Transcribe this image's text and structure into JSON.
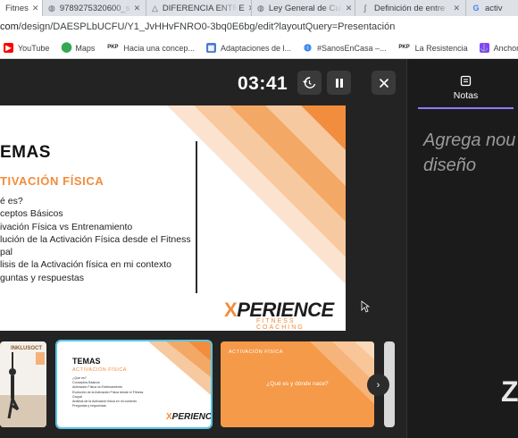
{
  "browser": {
    "tabs": [
      {
        "label": "Fitnes",
        "active": true
      },
      {
        "label": "9789275320600_s"
      },
      {
        "label": "DIFERENCIA ENTRE"
      },
      {
        "label": "Ley General de Cul"
      },
      {
        "label": "Definición de entre"
      },
      {
        "label": "activ"
      }
    ],
    "url_host": "com",
    "url_path": "/design/DAESPLbUCFU/Y1_JvHHvFNRO0-3bq0E6bg/edit?layoutQuery=Presentación",
    "bookmarks": [
      {
        "label": "YouTube",
        "icon": "youtube-icon",
        "color": "#ff0000"
      },
      {
        "label": "Maps",
        "icon": "maps-pin-icon",
        "color": "#34a853"
      },
      {
        "label": "Hacia una concep...",
        "icon": "pkp-icon",
        "color": "#222222"
      },
      {
        "label": "Adaptaciones de l...",
        "icon": "grid-icon",
        "color": "#4a7bd0"
      },
      {
        "label": "#SanosEnCasa –...",
        "icon": "globe-icon",
        "color": "#1a73e8"
      },
      {
        "label": "La Resistencia",
        "icon": "pkp-icon",
        "color": "#222222"
      },
      {
        "label": "Anchor: la",
        "icon": "anchor-icon",
        "color": "#8940fa"
      }
    ]
  },
  "presenter": {
    "timer": "03:41",
    "controls": {
      "reset": "history-reset-icon",
      "pause": "pause-icon",
      "close": "close-icon"
    }
  },
  "slide": {
    "title": "EMAS",
    "subtitle": "TIVACIÓN FÍSICA",
    "items": [
      "é es?",
      "ceptos Básicos",
      "ivación Física vs Entrenamiento",
      "lución de la Activación Física desde el Fitness",
      "pal",
      "lisis de la Activación física en mi contexto",
      "guntas y respuestas"
    ],
    "logo_main": "PERIENCE",
    "logo_x": "X",
    "logo_sub": "FITNESS COACHING",
    "accent": "#f28c3a"
  },
  "thumbnails": {
    "thumb1_label": "INKLUSOCT",
    "thumb2": {
      "title": "TEMAS",
      "subtitle": "ACTIVACIÓN FÍSICA",
      "items": [
        "¿Qué es?",
        "Conceptos Básicos",
        "Activación Física vs Entrenamiento",
        "Evolución de la Activación Física desde el Fitness",
        "Grupal",
        "Análisis de la Activación física en mi contexto",
        "Preguntas y respuestas"
      ],
      "logo": "PERIENCE"
    },
    "thumb3": {
      "heading": "ACTIVACIÓN FÍSICA",
      "center": "¿Qué es y dónde nace?"
    },
    "next_icon": "chevron-right-icon"
  },
  "notes": {
    "tab_label": "Notas",
    "placeholder": "Agrega nou diseño",
    "placeholder_line1": "Agrega nou",
    "placeholder_line2": "diseño",
    "corner_mark": "Z"
  }
}
